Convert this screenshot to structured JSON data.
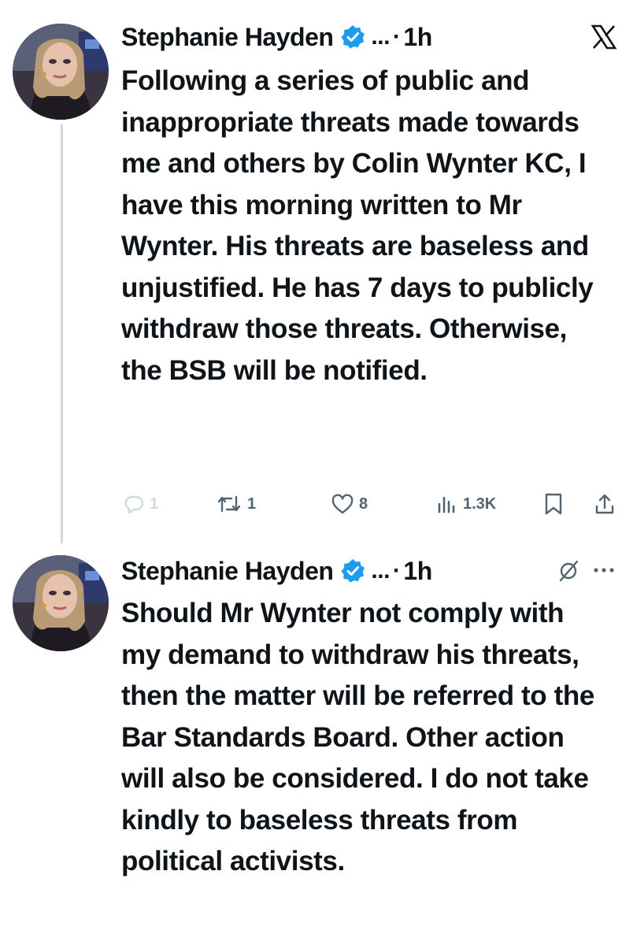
{
  "tweets": [
    {
      "author": "Stephanie Hayden",
      "ellipsis": "...",
      "separator": "·",
      "time": "1h",
      "text": "Following a series of public and inappropriate threats made towards me and others by Colin Wynter KC, I have this morning written to Mr Wynter. His threats are baseless and unjustified. He has 7 days to publicly withdraw those threats. Otherwise, the BSB will be notified.",
      "actions": {
        "replies": "1",
        "reposts": "1",
        "likes": "8",
        "views": "1.3K"
      }
    },
    {
      "author": "Stephanie Hayden",
      "ellipsis": "...",
      "separator": "·",
      "time": "1h",
      "text": "Should Mr Wynter not comply with my demand to withdraw his threats, then the matter will be referred to the Bar Standards Board. Other action will also be considered. I do not take kindly to baseless threats from political activists."
    }
  ],
  "icons": {
    "brand": "x-logo-icon",
    "verified": "verified-badge-icon",
    "reply": "reply-icon",
    "repost": "repost-icon",
    "like": "heart-icon",
    "views": "views-icon",
    "bookmark": "bookmark-icon",
    "share": "share-icon",
    "hidden": "hidden-reply-icon",
    "more": "more-icon"
  },
  "colors": {
    "verified_blue": "#1d9bf0",
    "text": "#0f1419",
    "muted": "#536471",
    "reply_icon": "#cfd9de",
    "thread_line": "#cfd9de"
  }
}
